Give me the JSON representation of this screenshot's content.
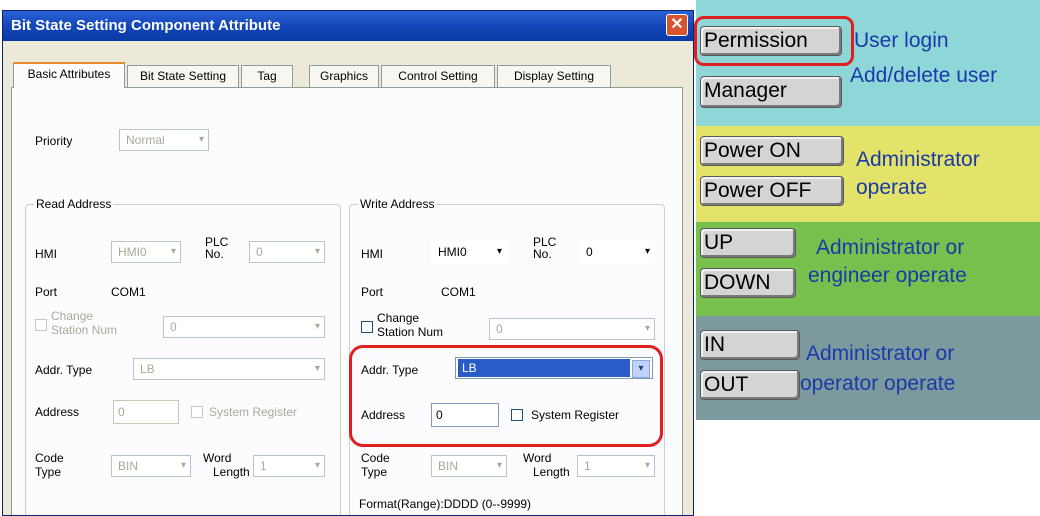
{
  "dialog": {
    "title": "Bit State Setting Component Attribute",
    "close_glyph": "✕",
    "tabs": [
      "Basic Attributes",
      "Bit State Setting",
      "Tag",
      "Graphics",
      "Control Setting",
      "Display Setting"
    ],
    "priority": {
      "label": "Priority",
      "value": "Normal"
    },
    "read": {
      "legend": "Read Address",
      "hmi_label": "HMI",
      "hmi_value": "HMI0",
      "plc_label_1": "PLC",
      "plc_label_2": "No.",
      "plc_value": "0",
      "port_label": "Port",
      "port_value": "COM1",
      "station_label_1": "Change",
      "station_label_2": "Station Num",
      "station_value": "0",
      "addr_type_label": "Addr. Type",
      "addr_type_value": "LB",
      "address_label": "Address",
      "address_value": "0",
      "sysreg_label": "System Register",
      "code_label_1": "Code",
      "code_label_2": "Type",
      "code_value": "BIN",
      "word_label_1": "Word",
      "word_label_2": "Length",
      "word_value": "1"
    },
    "write": {
      "legend": "Write Address",
      "hmi_label": "HMI",
      "hmi_value": "HMI0",
      "plc_label_1": "PLC",
      "plc_label_2": "No.",
      "plc_value": "0",
      "port_label": "Port",
      "port_value": "COM1",
      "station_label_1": "Change",
      "station_label_2": "Station Num",
      "station_value": "0",
      "addr_type_label": "Addr. Type",
      "addr_type_value": "LB",
      "address_label": "Address",
      "address_value": "0",
      "sysreg_label": "System Register",
      "code_label_1": "Code",
      "code_label_2": "Type",
      "code_value": "BIN",
      "word_label_1": "Word",
      "word_label_2": "Length",
      "word_value": "1",
      "format_text": "Format(Range):DDDD (0--9999)"
    },
    "arrow_glyph": "▾"
  },
  "panel": {
    "colors": {
      "cyan": "#8fd6d8",
      "yellow": "#e3e36a",
      "green": "#78c04e",
      "gray": "#7c9a9e",
      "highlight": "#e02020"
    },
    "rows": {
      "permission_button": "Permission",
      "permission_desc": "User login",
      "manager_button": "Manager",
      "manager_desc": "Add/delete user",
      "power_on_button": "Power ON",
      "power_off_button": "Power OFF",
      "power_desc_1": "Administrator",
      "power_desc_2": "operate",
      "up_button": "UP",
      "down_button": "DOWN",
      "updown_desc_1": "Administrator or",
      "updown_desc_2": "engineer operate",
      "in_button": "IN",
      "out_button": "OUT",
      "inout_desc_1": "Administrator or",
      "inout_desc_2": "operator operate"
    }
  }
}
